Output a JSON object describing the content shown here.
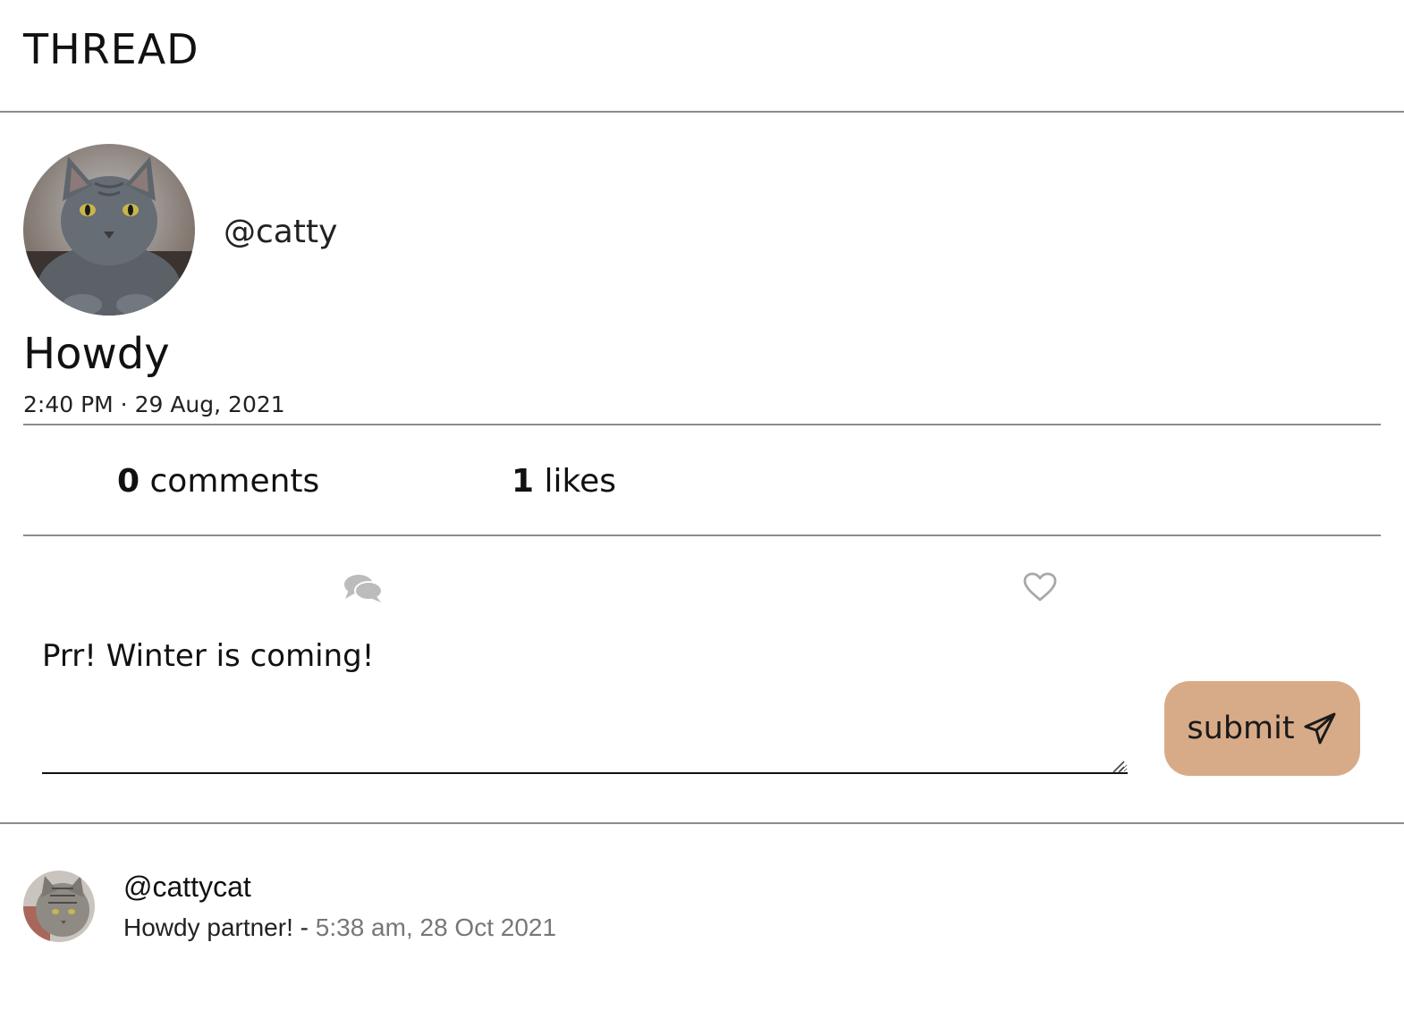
{
  "header": {
    "title": "THREAD"
  },
  "post": {
    "author_handle": "@catty",
    "title": "Howdy",
    "timestamp": "2:40 PM · 29 Aug, 2021",
    "stats": {
      "comments_count": "0",
      "comments_label": " comments",
      "likes_count": "1",
      "likes_label": " likes"
    },
    "actions": {
      "comment_icon": "comments-icon",
      "like_icon": "heart-outline-icon"
    }
  },
  "reply_form": {
    "value": "Prr! Winter is coming!",
    "submit_label": "submit",
    "submit_icon": "paper-plane-icon",
    "accent_color": "#d8ab88"
  },
  "comments": [
    {
      "author": "@cattycat",
      "text": "Howdy partner!",
      "separator": " - ",
      "time": "5:38 am, 28 Oct 2021"
    }
  ]
}
